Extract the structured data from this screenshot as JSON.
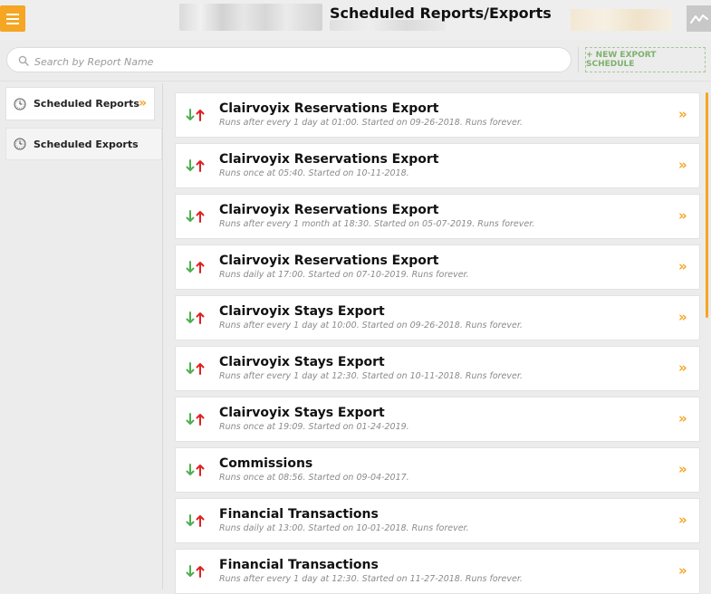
{
  "header": {
    "title": "Scheduled Reports/Exports",
    "menu_icon": "hamburger-menu-icon",
    "activity_icon": "activity-chart-icon"
  },
  "search": {
    "placeholder": "Search by Report Name",
    "value": ""
  },
  "toolbar": {
    "new_export_label": "+ NEW EXPORT SCHEDULE"
  },
  "sidebar": {
    "items": [
      {
        "label": "Scheduled Reports",
        "active": true
      },
      {
        "label": "Scheduled Exports",
        "active": false
      }
    ]
  },
  "exports": [
    {
      "title": "Clairvoyix Reservations Export",
      "schedule": "Runs after every 1 day at 01:00. Started on 09-26-2018. Runs forever."
    },
    {
      "title": "Clairvoyix Reservations Export",
      "schedule": "Runs once at 05:40. Started on 10-11-2018."
    },
    {
      "title": "Clairvoyix Reservations Export",
      "schedule": "Runs after every 1 month at 18:30. Started on 05-07-2019. Runs forever."
    },
    {
      "title": "Clairvoyix Reservations Export",
      "schedule": "Runs daily at 17:00. Started on 07-10-2019. Runs forever."
    },
    {
      "title": "Clairvoyix Stays Export",
      "schedule": "Runs after every 1 day at 10:00. Started on 09-26-2018. Runs forever."
    },
    {
      "title": "Clairvoyix Stays Export",
      "schedule": "Runs after every 1 day at 12:30. Started on 10-11-2018. Runs forever."
    },
    {
      "title": "Clairvoyix Stays Export",
      "schedule": "Runs once at 19:09. Started on 01-24-2019."
    },
    {
      "title": "Commissions",
      "schedule": "Runs once at 08:56. Started on 09-04-2017."
    },
    {
      "title": "Financial Transactions",
      "schedule": "Runs daily at 13:00. Started on 10-01-2018. Runs forever."
    },
    {
      "title": "Financial Transactions",
      "schedule": "Runs after every 1 day at 12:30. Started on 11-27-2018. Runs forever."
    }
  ],
  "colors": {
    "accent": "#f5a623",
    "new_button": "#7db16b",
    "arrow_down": "#4caf50",
    "arrow_up": "#e02020"
  }
}
